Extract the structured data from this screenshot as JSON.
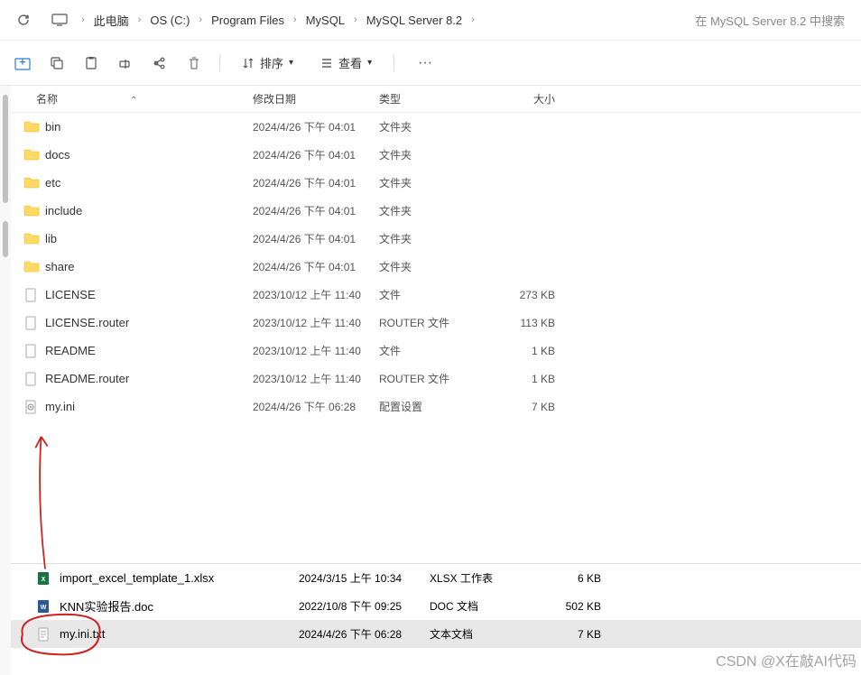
{
  "breadcrumb": {
    "items": [
      "此电脑",
      "OS (C:)",
      "Program Files",
      "MySQL",
      "MySQL Server 8.2"
    ]
  },
  "search": {
    "placeholder": "在 MySQL Server 8.2 中搜索"
  },
  "toolbar": {
    "sort_label": "排序",
    "view_label": "查看"
  },
  "columns": {
    "name": "名称",
    "date": "修改日期",
    "type": "类型",
    "size": "大小"
  },
  "files": [
    {
      "icon": "folder",
      "name": "bin",
      "date": "2024/4/26 下午 04:01",
      "type": "文件夹",
      "size": ""
    },
    {
      "icon": "folder",
      "name": "docs",
      "date": "2024/4/26 下午 04:01",
      "type": "文件夹",
      "size": ""
    },
    {
      "icon": "folder",
      "name": "etc",
      "date": "2024/4/26 下午 04:01",
      "type": "文件夹",
      "size": ""
    },
    {
      "icon": "folder",
      "name": "include",
      "date": "2024/4/26 下午 04:01",
      "type": "文件夹",
      "size": ""
    },
    {
      "icon": "folder",
      "name": "lib",
      "date": "2024/4/26 下午 04:01",
      "type": "文件夹",
      "size": ""
    },
    {
      "icon": "folder",
      "name": "share",
      "date": "2024/4/26 下午 04:01",
      "type": "文件夹",
      "size": ""
    },
    {
      "icon": "file",
      "name": "LICENSE",
      "date": "2023/10/12 上午 11:40",
      "type": "文件",
      "size": "273 KB"
    },
    {
      "icon": "file",
      "name": "LICENSE.router",
      "date": "2023/10/12 上午 11:40",
      "type": "ROUTER 文件",
      "size": "113 KB"
    },
    {
      "icon": "file",
      "name": "README",
      "date": "2023/10/12 上午 11:40",
      "type": "文件",
      "size": "1 KB"
    },
    {
      "icon": "file",
      "name": "README.router",
      "date": "2023/10/12 上午 11:40",
      "type": "ROUTER 文件",
      "size": "1 KB"
    },
    {
      "icon": "ini",
      "name": "my.ini",
      "date": "2024/4/26 下午 06:28",
      "type": "配置设置",
      "size": "7 KB"
    }
  ],
  "bottom_files": [
    {
      "icon": "xlsx",
      "name": "import_excel_template_1.xlsx",
      "date": "2024/3/15 上午 10:34",
      "type": "XLSX 工作表",
      "size": "6 KB"
    },
    {
      "icon": "doc",
      "name": "KNN实验报告.doc",
      "date": "2022/10/8 下午 09:25",
      "type": "DOC 文档",
      "size": "502 KB"
    },
    {
      "icon": "txt",
      "name": "my.ini.txt",
      "date": "2024/4/26 下午 06:28",
      "type": "文本文档",
      "size": "7 KB",
      "selected": true
    }
  ],
  "watermark": "CSDN @X在敲AI代码"
}
